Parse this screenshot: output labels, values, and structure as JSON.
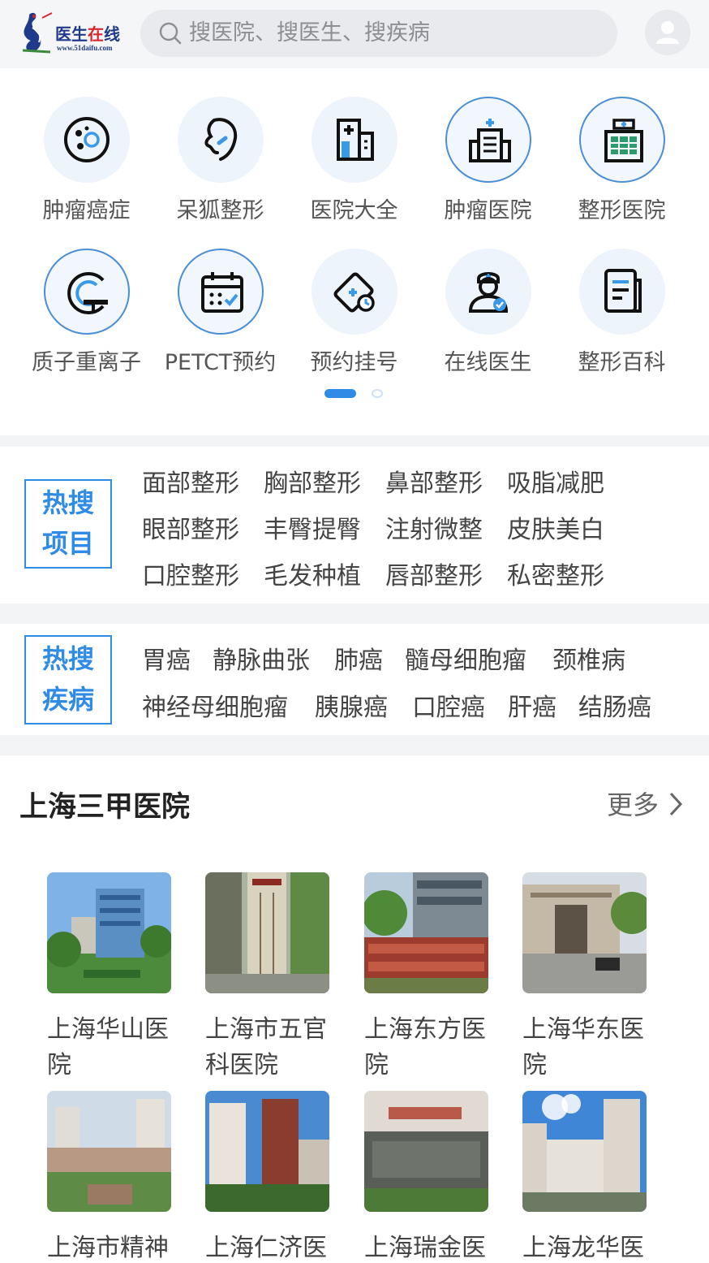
{
  "header": {
    "logo_text_part1": "医生",
    "logo_text_part2": "在",
    "logo_text_part3": "线",
    "logo_url": "www.51daifu.com",
    "search_placeholder": "搜医院、搜医生、搜疾病"
  },
  "grid": [
    {
      "label": "肿瘤癌症",
      "icon": "tumor-cell-icon"
    },
    {
      "label": "呆狐整形",
      "icon": "face-profile-icon"
    },
    {
      "label": "医院大全",
      "icon": "hospital-building-icon"
    },
    {
      "label": "肿瘤医院",
      "icon": "clinic-building-icon"
    },
    {
      "label": "整形医院",
      "icon": "hospital-block-icon"
    },
    {
      "label": "质子重离子",
      "icon": "proton-machine-icon"
    },
    {
      "label": "PETCT预约",
      "icon": "calendar-icon"
    },
    {
      "label": "预约挂号",
      "icon": "appointment-tag-icon"
    },
    {
      "label": "在线医生",
      "icon": "doctor-icon"
    },
    {
      "label": "整形百科",
      "icon": "document-icon"
    }
  ],
  "hot_projects": {
    "badge_line1": "热搜",
    "badge_line2": "项目",
    "rows": [
      [
        "面部整形",
        "胸部整形",
        "鼻部整形",
        "吸脂减肥"
      ],
      [
        "眼部整形",
        "丰臀提臀",
        "注射微整",
        "皮肤美白"
      ],
      [
        "口腔整形",
        "毛发种植",
        "唇部整形",
        "私密整形"
      ]
    ]
  },
  "hot_diseases": {
    "badge_line1": "热搜",
    "badge_line2": "疾病",
    "rows": [
      [
        "胃癌",
        "静脉曲张",
        "肺癌",
        "髓母细胞瘤",
        "颈椎病"
      ],
      [
        "神经母细胞瘤",
        "胰腺癌",
        "口腔癌",
        "肝癌",
        "结肠癌"
      ]
    ]
  },
  "hospitals_section": {
    "title": "上海三甲医院",
    "more_label": "更多",
    "items": [
      {
        "name": "上海华山医院"
      },
      {
        "name": "上海市五官科医院"
      },
      {
        "name": "上海东方医院"
      },
      {
        "name": "上海华东医院"
      },
      {
        "name": "上海市精神"
      },
      {
        "name": "上海仁济医"
      },
      {
        "name": "上海瑞金医"
      },
      {
        "name": "上海龙华医"
      }
    ]
  },
  "colors": {
    "accent": "#2f8be6",
    "header_bg": "#f5f6f8",
    "separator": "#f3f4f6"
  }
}
